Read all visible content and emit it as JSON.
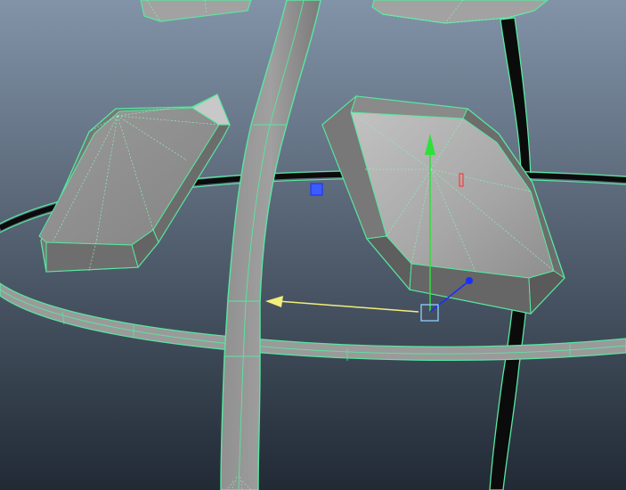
{
  "viewport": {
    "background_top": "#8293a8",
    "background_bottom": "#212a35"
  },
  "colors": {
    "wire": "#57e8a0",
    "wire_dashed": "#8cf0b8",
    "mesh_light": "#a8a8a8",
    "mesh_mid": "#8a8a8a",
    "mesh_dark": "#676767",
    "curve_black": "#0b0b0b",
    "gizmo_y_axis": "#2fe03a",
    "gizmo_z_axis": "#1a2dff",
    "gizmo_x_axis": "#ff3b3b",
    "gizmo_yellow": "#f2ef7a",
    "gizmo_center": "#8fd0ff"
  },
  "icons": {
    "y_axis_arrow": "green-cone-arrow",
    "z_axis_handle": "blue-dot-handle",
    "x_axis_handle": "red-square-handle",
    "plane_handle": "blue-square-handle",
    "pivot": "square-pivot-handle"
  }
}
